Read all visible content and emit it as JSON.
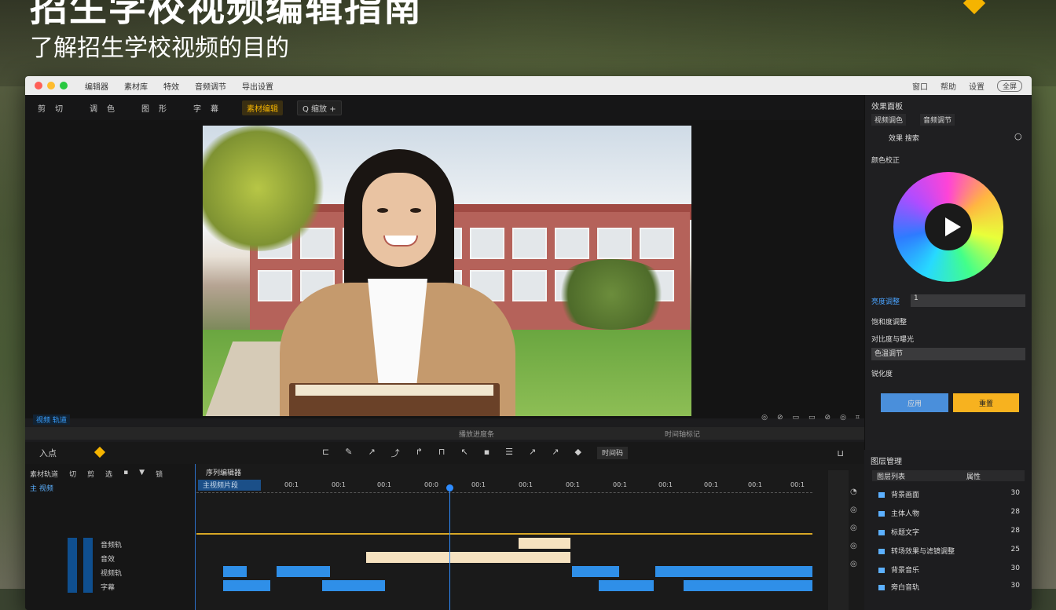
{
  "overlay": {
    "headline": "招生学校视频编辑指南",
    "subline": "了解招生学校视频的目的"
  },
  "window": {
    "menus": [
      "编辑器",
      "素材库",
      "特效",
      "音频调节",
      "导出设置"
    ],
    "titlebar_right": [
      "窗口",
      "帮助",
      "设置",
      "全屏"
    ]
  },
  "toolbar": {
    "group1": [
      "剪",
      "切"
    ],
    "group2": [
      "调",
      "色"
    ],
    "group3": [
      "图",
      "形"
    ],
    "group4": [
      "字",
      "幕"
    ],
    "active_tool": "素材编辑",
    "zoom": "Q 缩放 +"
  },
  "viewer_controls": {
    "track_badge": "视频 轨道",
    "right_icons": [
      "◎",
      "⊘",
      "▭",
      "▭",
      "⊘",
      "◎",
      "⌗"
    ]
  },
  "scrubber": {
    "left_label": "播放进度条",
    "right_label": "时间轴标记"
  },
  "controls": {
    "left_label": "入点",
    "tools": [
      "⊏",
      "✎",
      "↗",
      "⤴",
      "↱",
      "⊓",
      "↖",
      "▪",
      "☰",
      "↗",
      "↗",
      "◆"
    ],
    "timecode_btn": "时间码",
    "right_icon": "⊔"
  },
  "timeline": {
    "header_tabs": [
      "素材轨道",
      "切",
      "剪",
      "选",
      "▪",
      "▼",
      "锁"
    ],
    "header_sub": "主 视频",
    "track_labels": [
      "音频轨",
      "音效",
      "视频轨",
      "字幕"
    ],
    "clip_title": "主视频片段",
    "sequence_label": "序列编辑器",
    "ruler_marks": [
      "00:1",
      "00:1",
      "00:1",
      "00:0",
      "00:1",
      "00:1",
      "00:1",
      "00:1",
      "00:1",
      "00:1",
      "00:1",
      "00:1"
    ],
    "side_icons": [
      "◔",
      "◎",
      "◎",
      "◎",
      "◎"
    ]
  },
  "inspector": {
    "title": "效果面板",
    "tabs": [
      "视频调色",
      "音频调节"
    ],
    "search_label": "效果 搜索",
    "section_color": "颜色校正",
    "field1_label": "亮度调整",
    "field1_value": "1",
    "label2": "饱和度调整",
    "label3": "对比度与曝光",
    "field3_value": "色温调节",
    "label4": "锐化度",
    "btn_apply": "应用",
    "btn_reset": "重置"
  },
  "layers": {
    "title": "图层管理",
    "header_left": "图层列表",
    "header_right": "属性",
    "items": [
      {
        "label": "背景画面",
        "value": "30"
      },
      {
        "label": "主体人物",
        "value": "28"
      },
      {
        "label": "标题文字",
        "value": "28"
      },
      {
        "label": "转场效果与滤镜调整",
        "value": "25"
      },
      {
        "label": "背景音乐",
        "value": "30"
      },
      {
        "label": "旁白音轨",
        "value": "30"
      }
    ]
  },
  "colors": {
    "accent_yellow": "#f5b400",
    "accent_blue": "#2e8cff",
    "panel_bg": "#1c1c1e"
  }
}
